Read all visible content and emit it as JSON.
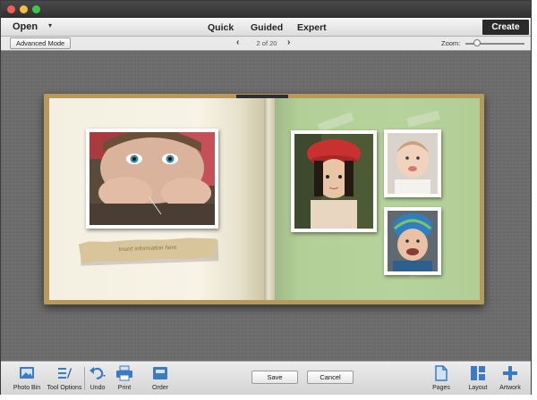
{
  "header": {
    "open_label": "Open",
    "tabs": [
      {
        "label": "Quick"
      },
      {
        "label": "Guided"
      },
      {
        "label": "Expert"
      }
    ],
    "create_label": "Create"
  },
  "subbar": {
    "advanced_mode_label": "Advanced Mode",
    "page_indicator": "2 of 20",
    "zoom_label": "Zoom:",
    "zoom_level": 0.15
  },
  "book": {
    "left_page": {
      "caption_placeholder": "Insert information here"
    }
  },
  "toolbar": {
    "left_tools": [
      {
        "label": "Photo Bin",
        "icon": "photo-bin-icon"
      },
      {
        "label": "Tool Options",
        "icon": "tool-options-icon"
      },
      {
        "label": "Undo",
        "icon": "undo-icon"
      },
      {
        "label": "Print",
        "icon": "print-icon"
      },
      {
        "label": "Order",
        "icon": "order-icon"
      }
    ],
    "save_label": "Save",
    "cancel_label": "Cancel",
    "right_tools": [
      {
        "label": "Pages",
        "icon": "pages-icon"
      },
      {
        "label": "Layout",
        "icon": "layout-icon"
      },
      {
        "label": "Artwork",
        "icon": "artwork-icon"
      }
    ]
  },
  "colors": {
    "accent": "#2a6fb8",
    "create_button": "#2a2a2a",
    "page_green": "#b7d39c",
    "page_cream": "#f5f1e3"
  }
}
